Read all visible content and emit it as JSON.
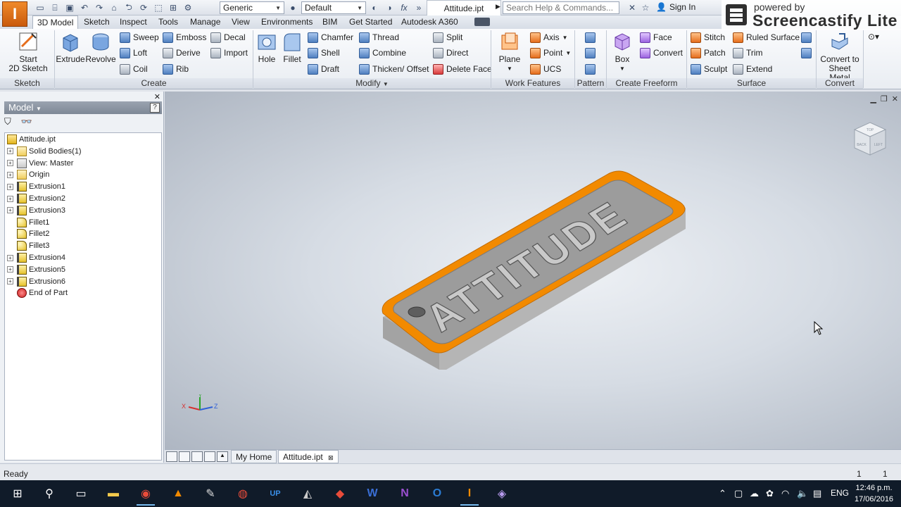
{
  "titlebar": {
    "material": "Generic",
    "appearance": "Default",
    "document_title": "Attitude.ipt",
    "search_placeholder": "Search Help & Commands...",
    "sign_in": "Sign In"
  },
  "watermark": {
    "line1": "powered by",
    "line2": "Screencastify Lite"
  },
  "ribbon_tabs": [
    "3D Model",
    "Sketch",
    "Inspect",
    "Tools",
    "Manage",
    "View",
    "Environments",
    "BIM",
    "Get Started",
    "Autodesk A360"
  ],
  "active_tab": "3D Model",
  "ribbon": {
    "sketch": {
      "label": "Sketch",
      "start": "Start",
      "start2": "2D Sketch"
    },
    "create": {
      "label": "Create",
      "extrude": "Extrude",
      "revolve": "Revolve",
      "sweep": "Sweep",
      "loft": "Loft",
      "coil": "Coil",
      "emboss": "Emboss",
      "derive": "Derive",
      "rib": "Rib",
      "decal": "Decal",
      "import": "Import"
    },
    "modify": {
      "label": "Modify",
      "hole": "Hole",
      "fillet": "Fillet",
      "chamfer": "Chamfer",
      "shell": "Shell",
      "draft": "Draft",
      "thread": "Thread",
      "combine": "Combine",
      "thicken": "Thicken/ Offset",
      "split": "Split",
      "direct": "Direct",
      "delete_face": "Delete Face"
    },
    "work_features": {
      "label": "Work Features",
      "plane": "Plane",
      "axis": "Axis",
      "point": "Point",
      "ucs": "UCS"
    },
    "pattern": {
      "label": "Pattern"
    },
    "freeform": {
      "label": "Create Freeform",
      "box": "Box",
      "face": "Face",
      "convert": "Convert"
    },
    "surface": {
      "label": "Surface",
      "stitch": "Stitch",
      "patch": "Patch",
      "sculpt": "Sculpt",
      "ruled": "Ruled Surface",
      "trim": "Trim",
      "extend": "Extend"
    },
    "convert": {
      "label": "Convert",
      "sheet1": "Convert to",
      "sheet2": "Sheet Metal"
    }
  },
  "browser": {
    "title": "Model",
    "tree": [
      {
        "label": "Attitude.ipt",
        "icon": "part-icon",
        "expandable": false,
        "indent": 0
      },
      {
        "label": "Solid Bodies(1)",
        "icon": "solid-bodies-folder-icon",
        "expandable": true,
        "indent": 1
      },
      {
        "label": "View: Master",
        "icon": "view-icon",
        "expandable": true,
        "indent": 1
      },
      {
        "label": "Origin",
        "icon": "origin-folder-icon",
        "expandable": true,
        "indent": 1
      },
      {
        "label": "Extrusion1",
        "icon": "extrusion-icon",
        "expandable": true,
        "indent": 1
      },
      {
        "label": "Extrusion2",
        "icon": "extrusion-icon",
        "expandable": true,
        "indent": 1
      },
      {
        "label": "Extrusion3",
        "icon": "extrusion-icon",
        "expandable": true,
        "indent": 1
      },
      {
        "label": "Fillet1",
        "icon": "fillet-icon",
        "expandable": false,
        "indent": 1
      },
      {
        "label": "Fillet2",
        "icon": "fillet-icon",
        "expandable": false,
        "indent": 1
      },
      {
        "label": "Fillet3",
        "icon": "fillet-icon",
        "expandable": false,
        "indent": 1
      },
      {
        "label": "Extrusion4",
        "icon": "extrusion-icon",
        "expandable": true,
        "indent": 1
      },
      {
        "label": "Extrusion5",
        "icon": "extrusion-icon",
        "expandable": true,
        "indent": 1
      },
      {
        "label": "Extrusion6",
        "icon": "extrusion-icon",
        "expandable": true,
        "indent": 1
      },
      {
        "label": "End of Part",
        "icon": "end-of-part-icon",
        "expandable": false,
        "indent": 1
      }
    ]
  },
  "viewport": {
    "model_text": "ATTITUDE",
    "viewcube_top": "TOP",
    "viewcube_left": "BACK",
    "viewcube_right": "LEFT",
    "axis_x": "X",
    "axis_y": "Y",
    "axis_z": "Z",
    "highlight_color": "#f28a00"
  },
  "doc_tabs": {
    "home": "My Home",
    "document": "Attitude.ipt"
  },
  "status": {
    "text": "Ready",
    "n1": "1",
    "n2": "1"
  },
  "taskbar": {
    "input_lang": "ENG",
    "time": "12:46 p.m.",
    "date": "17/06/2016"
  }
}
